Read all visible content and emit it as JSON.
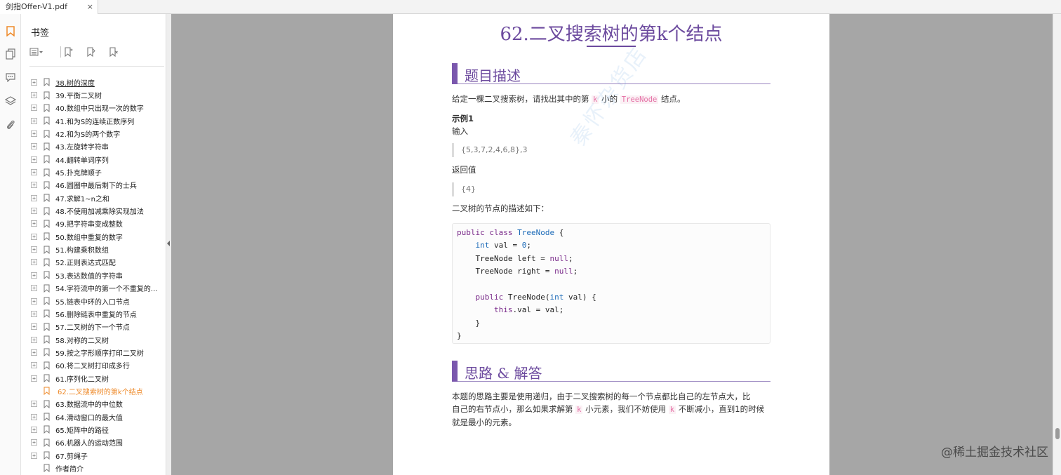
{
  "tab": {
    "title": "剑指Offer-V1.pdf",
    "close": "×"
  },
  "rail": {
    "icons": [
      "bookmark-icon",
      "pages-icon",
      "comment-icon",
      "layers-icon",
      "attachment-icon"
    ]
  },
  "panel": {
    "title": "书签",
    "items": [
      {
        "label": "38.树的深度",
        "expandable": true,
        "underlined": true,
        "active": false
      },
      {
        "label": "39.平衡二叉树",
        "expandable": true,
        "active": false
      },
      {
        "label": "40.数组中只出现一次的数字",
        "expandable": true,
        "active": false
      },
      {
        "label": "41.和为S的连续正数序列",
        "expandable": true,
        "active": false
      },
      {
        "label": "42.和为S的两个数字",
        "expandable": true,
        "active": false
      },
      {
        "label": "43.左旋转字符串",
        "expandable": true,
        "active": false
      },
      {
        "label": "44.翻转单词序列",
        "expandable": true,
        "active": false
      },
      {
        "label": "45.扑克牌顺子",
        "expandable": true,
        "active": false
      },
      {
        "label": "46.圆圈中最后剩下的士兵",
        "expandable": true,
        "active": false
      },
      {
        "label": "47.求解1~n之和",
        "expandable": true,
        "active": false
      },
      {
        "label": "48.不使用加减乘除实现加法",
        "expandable": true,
        "active": false
      },
      {
        "label": "49.把字符串变成整数",
        "expandable": true,
        "active": false
      },
      {
        "label": "50.数组中重复的数字",
        "expandable": true,
        "active": false
      },
      {
        "label": "51.构建乘积数组",
        "expandable": true,
        "active": false
      },
      {
        "label": "52.正则表达式匹配",
        "expandable": true,
        "active": false
      },
      {
        "label": "53.表达数值的字符串",
        "expandable": true,
        "active": false
      },
      {
        "label": "54.字符流中的第一个不重复的...",
        "expandable": true,
        "active": false
      },
      {
        "label": "55.链表中环的入口节点",
        "expandable": true,
        "active": false
      },
      {
        "label": "56.删除链表中重复的节点",
        "expandable": true,
        "active": false
      },
      {
        "label": "57.二叉树的下一个节点",
        "expandable": true,
        "active": false
      },
      {
        "label": "58.对称的二叉树",
        "expandable": true,
        "active": false
      },
      {
        "label": "59.按之字形顺序打印二叉树",
        "expandable": true,
        "active": false
      },
      {
        "label": "60.将二叉树打印成多行",
        "expandable": true,
        "active": false
      },
      {
        "label": "61.序列化二叉树",
        "expandable": true,
        "active": false
      },
      {
        "label": "62.二叉搜索树的第k个结点",
        "expandable": false,
        "active": true
      },
      {
        "label": "63.数据流中的中位数",
        "expandable": true,
        "active": false
      },
      {
        "label": "64.滑动窗口的最大值",
        "expandable": true,
        "active": false
      },
      {
        "label": "65.矩阵中的路径",
        "expandable": true,
        "active": false
      },
      {
        "label": "66.机器人的运动范围",
        "expandable": true,
        "active": false
      },
      {
        "label": "67.剪绳子",
        "expandable": true,
        "active": false
      },
      {
        "label": "作者简介",
        "expandable": false,
        "active": false
      }
    ]
  },
  "doc": {
    "title": "62.二叉搜索树的第k个结点",
    "section1": "题目描述",
    "desc_before": "给定一棵二叉搜索树，请找出其中的第",
    "desc_k": "k",
    "desc_mid": "小的",
    "desc_code": "TreeNode",
    "desc_after": "结点。",
    "example_label": "示例1",
    "input_label": "输入",
    "input_value": "{5,3,7,2,4,6,8},3",
    "output_label": "返回值",
    "output_value": "{4}",
    "node_desc": "二叉树的节点的描述如下：",
    "code": [
      [
        {
          "c": "kw",
          "t": "public"
        },
        {
          "c": "",
          "t": " "
        },
        {
          "c": "kw",
          "t": "class"
        },
        {
          "c": "",
          "t": " "
        },
        {
          "c": "ty",
          "t": "TreeNode"
        },
        {
          "c": "",
          "t": " {"
        }
      ],
      [
        {
          "c": "",
          "t": "    "
        },
        {
          "c": "ty",
          "t": "int"
        },
        {
          "c": "",
          "t": " val = "
        },
        {
          "c": "num",
          "t": "0"
        },
        {
          "c": "",
          "t": ";"
        }
      ],
      [
        {
          "c": "",
          "t": "    TreeNode left = "
        },
        {
          "c": "kw",
          "t": "null"
        },
        {
          "c": "",
          "t": ";"
        }
      ],
      [
        {
          "c": "",
          "t": "    TreeNode right = "
        },
        {
          "c": "kw",
          "t": "null"
        },
        {
          "c": "",
          "t": ";"
        }
      ],
      [
        {
          "c": "",
          "t": ""
        }
      ],
      [
        {
          "c": "",
          "t": "    "
        },
        {
          "c": "kw",
          "t": "public"
        },
        {
          "c": "",
          "t": " TreeNode("
        },
        {
          "c": "ty",
          "t": "int"
        },
        {
          "c": "",
          "t": " val) {"
        }
      ],
      [
        {
          "c": "",
          "t": "        "
        },
        {
          "c": "kw",
          "t": "this"
        },
        {
          "c": "",
          "t": ".val = val;"
        }
      ],
      [
        {
          "c": "",
          "t": "    }"
        }
      ],
      [
        {
          "c": "",
          "t": "}"
        }
      ]
    ],
    "section2": "思路 & 解答",
    "sol_1": "本题的思路主要是使用递归，由于二叉搜索树的每一个节点都比自己的左节点大，比",
    "sol_2a": "自己的右节点小，那么如果求解第",
    "sol_k1": "k",
    "sol_2b": "小元素，我们不妨使用",
    "sol_k2": "k",
    "sol_2c": "不断减小，直到1的时候",
    "sol_3": "就是最小的元素。",
    "watermark": "秦怀杂货店"
  },
  "site_mark": "@稀土掘金技术社区",
  "colors": {
    "accent": "#6c4a9e",
    "active_bookmark": "#ee8a2a",
    "inline_code": "#e56fa5",
    "viewer_bg": "#a6a6a6"
  }
}
